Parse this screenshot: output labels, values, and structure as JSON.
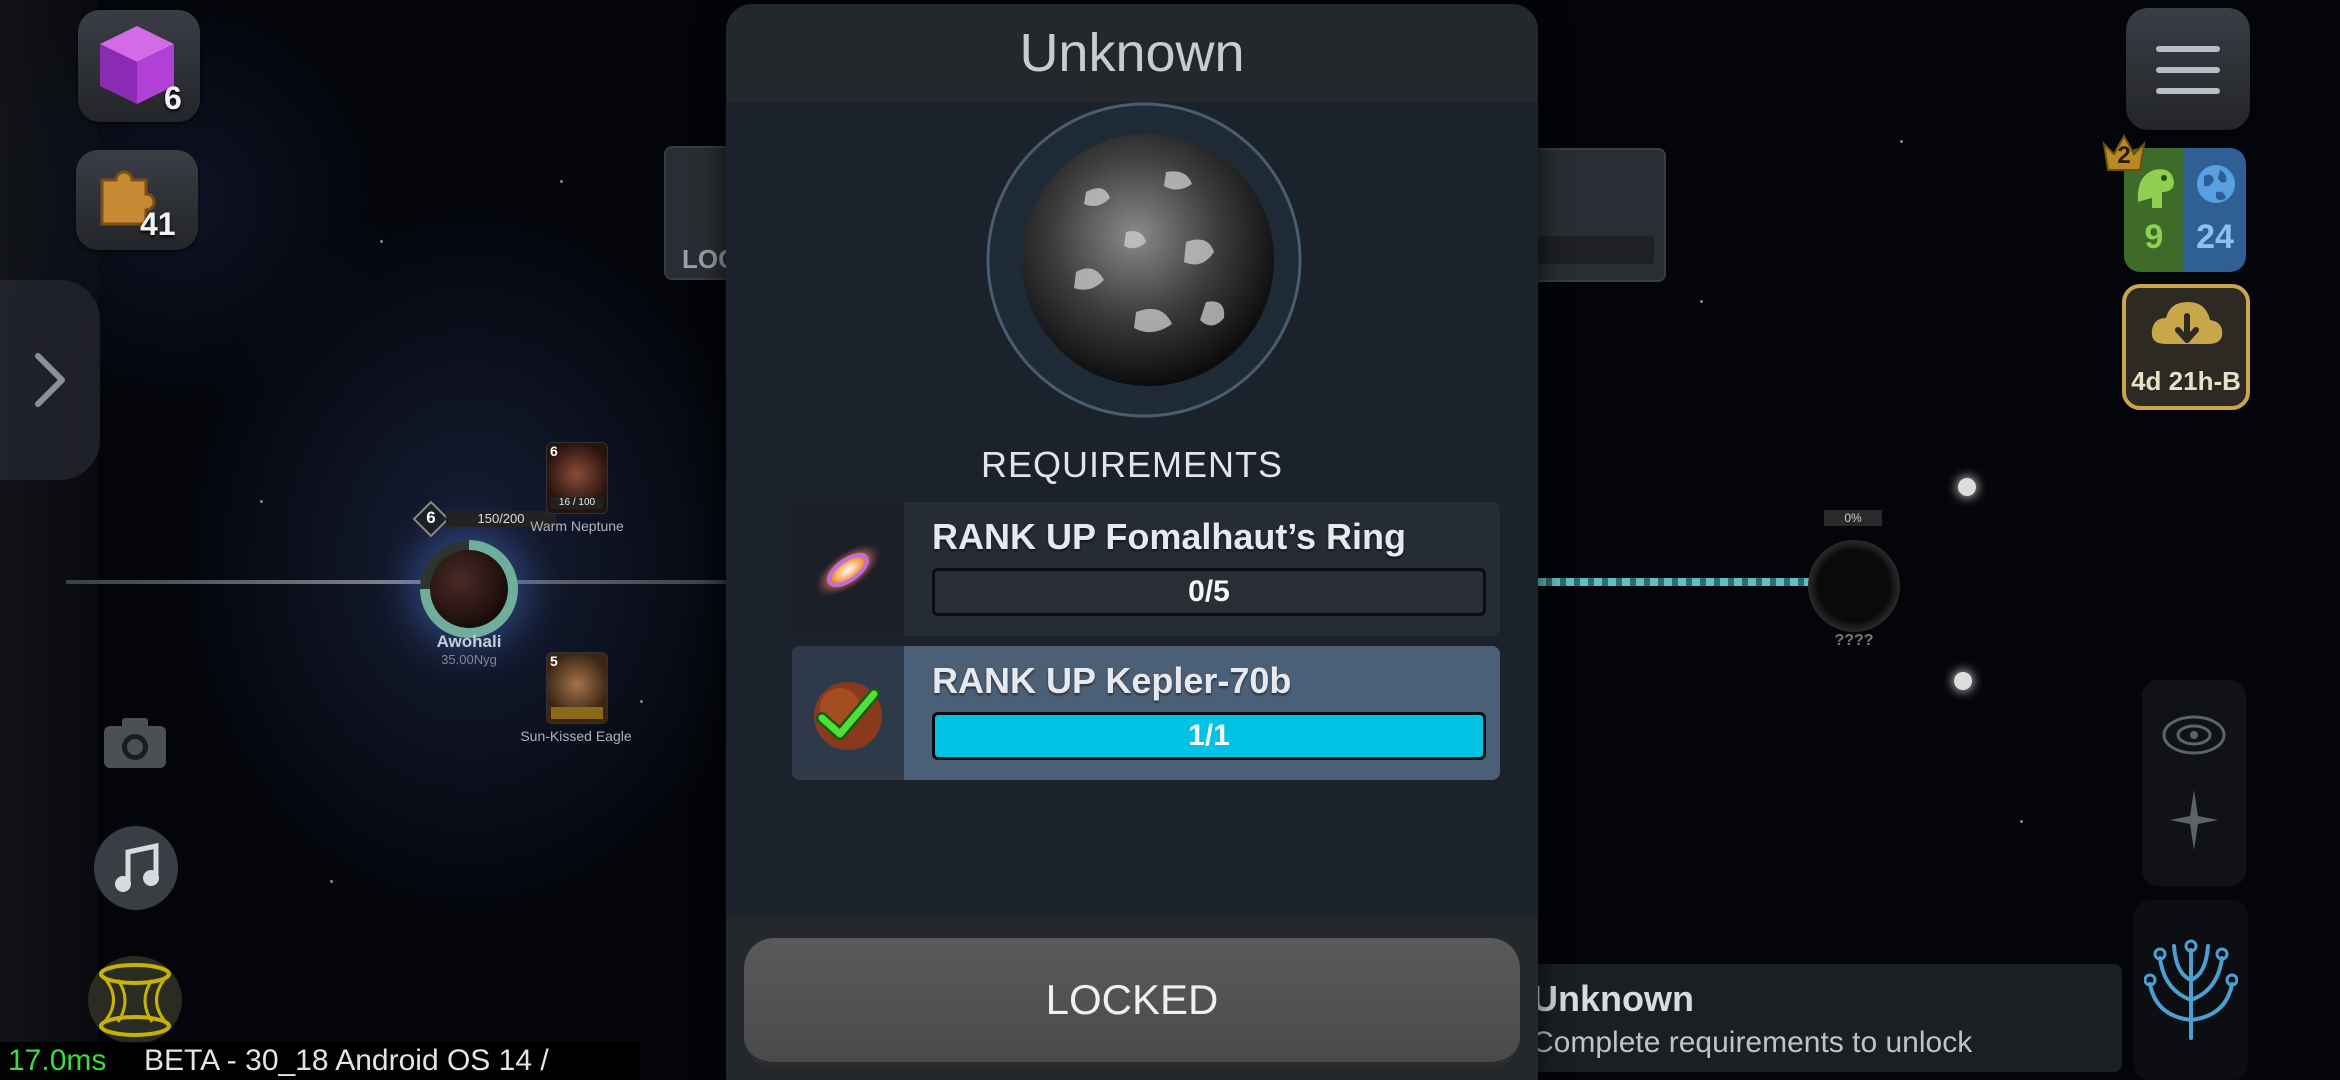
{
  "hud_left": {
    "cube_count": "6",
    "puzzle_count": "41"
  },
  "map": {
    "home_node": {
      "level": "6",
      "progress": "150/200",
      "name": "Awohali",
      "sub": "35.00Nyg"
    },
    "child_1": {
      "level": "6",
      "progress": "16 / 100",
      "name": "Warm Neptune"
    },
    "child_2": {
      "level": "5",
      "name": "Sun-Kissed Eagle"
    },
    "locked_tab": "LOC",
    "right_node": {
      "progress": "0%",
      "name": "????"
    }
  },
  "modal": {
    "title": "Unknown",
    "requirements_title": "REQUIREMENTS",
    "requirements": [
      {
        "label": "RANK UP Fomalhaut’s Ring",
        "progress": "0/5",
        "fraction": 0.0,
        "done": false
      },
      {
        "label": "RANK UP Kepler-70b",
        "progress": "1/1",
        "fraction": 1.0,
        "done": true
      }
    ],
    "button_label": "LOCKED"
  },
  "hud_right": {
    "crown_level": "2",
    "dino_count": "9",
    "globe_count": "24",
    "download_timer": "4d 21h-B"
  },
  "bottom_info": {
    "title": "Unknown",
    "subtitle": "Complete requirements to unlock"
  },
  "debug": {
    "frame_time": "17.0ms",
    "build": "BETA - 30_18 Android OS 14 /"
  },
  "colors": {
    "progress_fill": "#00c3e3",
    "done_bg": "#4b5f76",
    "pending_bg": "#252c36",
    "accent_gold": "#c9a64a"
  }
}
